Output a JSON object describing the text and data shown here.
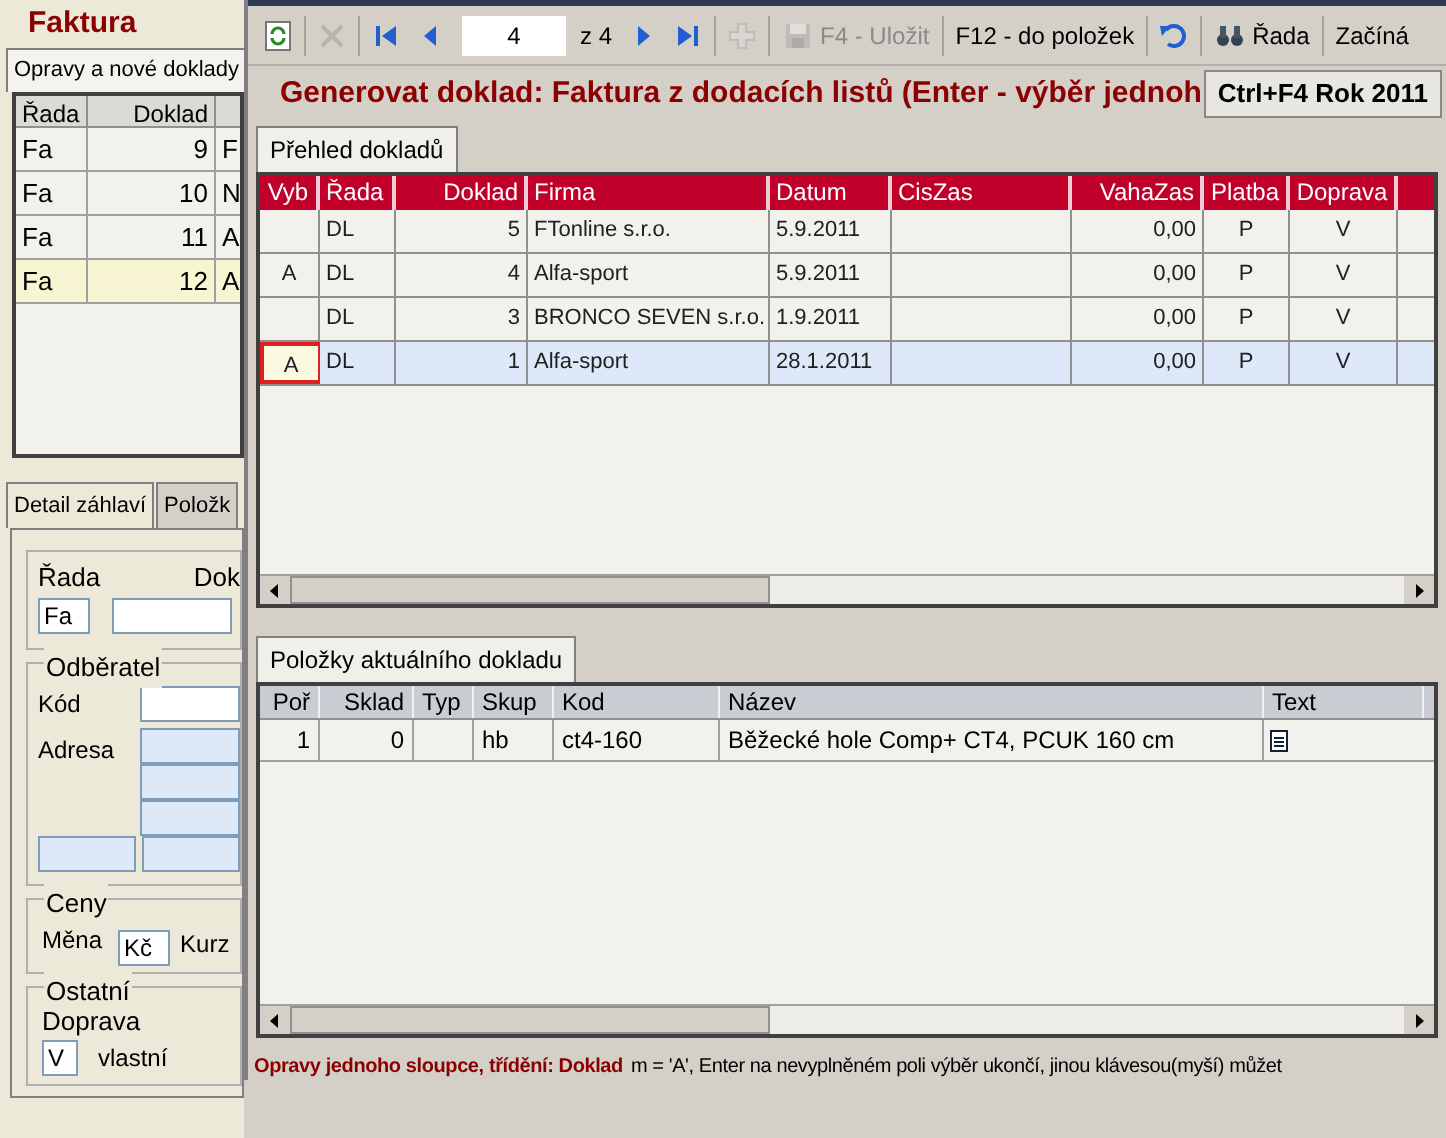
{
  "back_window": {
    "title": "Faktura",
    "list_tab": {
      "label": "Opravy a nové doklady",
      "selected": true
    },
    "table": {
      "columns": [
        "Řada",
        "Doklad"
      ],
      "rows": [
        {
          "cells": [
            "Fa",
            "9",
            "F"
          ],
          "selected": false
        },
        {
          "cells": [
            "Fa",
            "10",
            "N"
          ],
          "selected": false
        },
        {
          "cells": [
            "Fa",
            "11",
            "A"
          ],
          "selected": false
        },
        {
          "cells": [
            "Fa",
            "12",
            "A"
          ],
          "selected": true
        }
      ]
    },
    "detail_tabs": [
      {
        "label": "Detail záhlaví",
        "selected": true
      },
      {
        "label": "Položk",
        "selected": false
      }
    ],
    "header_group": {
      "rada_label": "Řada",
      "rada_value": "Fa",
      "doklad_label": "Dok"
    },
    "odberatel": {
      "title": "Odběratel",
      "kod_label": "Kód",
      "adresa_label": "Adresa"
    },
    "ceny": {
      "title": "Ceny",
      "mena_label": "Měna",
      "mena_value": "Kč",
      "kurz_label": "Kurz"
    },
    "ostatni": {
      "title": "Ostatní",
      "doprava_label": "Doprava",
      "doprava_value": "V",
      "doprava_text": "vlastní"
    }
  },
  "dialog": {
    "toolbar": [
      {
        "kind": "refresh",
        "disabled": false
      },
      {
        "kind": "sep"
      },
      {
        "kind": "delete",
        "disabled": true
      },
      {
        "kind": "sep"
      },
      {
        "kind": "first",
        "disabled": false
      },
      {
        "kind": "prev",
        "disabled": false
      },
      {
        "kind": "field",
        "value": "4"
      },
      {
        "kind": "text",
        "label": "z 4"
      },
      {
        "kind": "next",
        "disabled": false
      },
      {
        "kind": "last",
        "disabled": false
      },
      {
        "kind": "sep"
      },
      {
        "kind": "add",
        "disabled": true
      },
      {
        "kind": "sep"
      },
      {
        "kind": "save_button",
        "label": "F4 - Uložit",
        "disabled": true
      },
      {
        "kind": "sep"
      },
      {
        "kind": "text_button",
        "label": "F12 - do položek",
        "disabled": false
      },
      {
        "kind": "sep"
      },
      {
        "kind": "undo",
        "disabled": false
      },
      {
        "kind": "sep"
      },
      {
        "kind": "find_button",
        "label": "Řada",
        "disabled": false
      },
      {
        "kind": "sep"
      },
      {
        "kind": "text_button",
        "label": "Začíná",
        "disabled": false
      }
    ],
    "heading": "Generovat doklad: Faktura z dodacích listů (Enter - výběr jednoh",
    "year_button": "Ctrl+F4 Rok 2011",
    "documents": {
      "tab": {
        "label": "Přehled dokladů",
        "selected": true
      },
      "columns": [
        "Vyb",
        "Řada",
        "Doklad",
        "Firma",
        "Datum",
        "CisZas",
        "VahaZas",
        "Platba",
        "Doprava"
      ],
      "rows": [
        {
          "cells": [
            "",
            "DL",
            "5",
            "FTonline s.r.o.",
            "5.9.2011",
            "",
            "0,00",
            "P",
            "V"
          ],
          "selected": false,
          "focused": false
        },
        {
          "cells": [
            "A",
            "DL",
            "4",
            "Alfa-sport",
            "5.9.2011",
            "",
            "0,00",
            "P",
            "V"
          ],
          "selected": false,
          "focused": false
        },
        {
          "cells": [
            "",
            "DL",
            "3",
            "BRONCO SEVEN s.r.o.",
            "1.9.2011",
            "",
            "0,00",
            "P",
            "V"
          ],
          "selected": false,
          "focused": false
        },
        {
          "cells": [
            "A",
            "DL",
            "1",
            "Alfa-sport",
            "28.1.2011",
            "",
            "0,00",
            "P",
            "V"
          ],
          "selected": true,
          "focused": true
        }
      ]
    },
    "items": {
      "tab": {
        "label": "Položky aktuálního dokladu",
        "selected": true
      },
      "columns": [
        "Poř",
        "Sklad",
        "Typ",
        "Skup",
        "Kod",
        "Název",
        "Text"
      ],
      "rows": [
        {
          "cells": [
            "1",
            "0",
            "",
            "hb",
            "ct4-160",
            "Běžecké hole Comp+ CT4, PCUK 160 cm"
          ],
          "has_text": true
        }
      ]
    },
    "status": {
      "bold": "Opravy jednoho sloupce, třídění: Doklad",
      "text": "m = 'A', Enter na nevyplněném poli výběr ukončí, jinou klávesou(myší) můžet"
    }
  }
}
